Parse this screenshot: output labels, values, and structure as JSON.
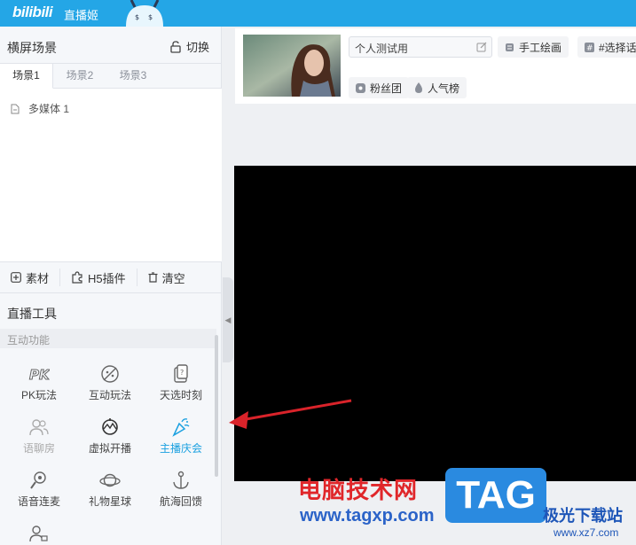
{
  "topbar": {
    "logo": "bilibili",
    "title": "直播姬"
  },
  "scene_panel": {
    "title": "横屏场景",
    "switch_label": "切换",
    "tabs": [
      {
        "label": "场景1",
        "active": true
      },
      {
        "label": "场景2",
        "active": false
      },
      {
        "label": "场景3",
        "active": false
      }
    ],
    "sources": [
      {
        "label": "多媒体 1"
      }
    ]
  },
  "source_bar": {
    "material": "素材",
    "h5_plugin": "H5插件",
    "clear": "清空"
  },
  "tools": {
    "title": "直播工具",
    "section": "互动功能",
    "items": [
      {
        "label": "PK玩法",
        "icon": "pk-icon"
      },
      {
        "label": "互动玩法",
        "icon": "interact-play-icon"
      },
      {
        "label": "天选时刻",
        "icon": "lucky-draw-icon"
      },
      {
        "label": "语聊房",
        "icon": "voice-room-icon",
        "disabled": true
      },
      {
        "label": "虚拟开播",
        "icon": "virtual-live-icon"
      },
      {
        "label": "主播庆会",
        "icon": "celebration-icon",
        "highlighted": true
      },
      {
        "label": "语音连麦",
        "icon": "voice-link-icon"
      },
      {
        "label": "礼物星球",
        "icon": "gift-planet-icon"
      },
      {
        "label": "航海回馈",
        "icon": "voyage-feedback-icon"
      }
    ]
  },
  "room": {
    "title_value": "个人测试用",
    "category": "手工绘画",
    "tag_select": "#选择话",
    "fan_club": "粉丝团",
    "popularity": "人气榜"
  },
  "watermark": {
    "site_name": "电脑技术网",
    "url": "www.tagxp.com",
    "badge": "TAG",
    "cn_site": "极光下载站",
    "site_url": "www.xz7.com"
  },
  "colors": {
    "accent": "#24a6e6",
    "highlight": "#1aa0e0",
    "arrow": "#d9232a"
  }
}
